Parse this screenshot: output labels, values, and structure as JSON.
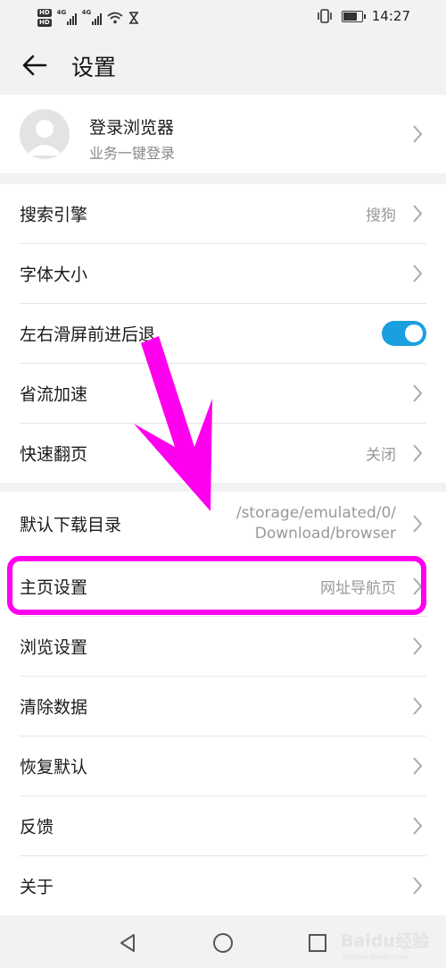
{
  "status_bar": {
    "hd_badges": [
      "HD",
      "HD"
    ],
    "network_labels": [
      "4G",
      "4G"
    ],
    "time": "14:27"
  },
  "header": {
    "title": "设置"
  },
  "account": {
    "name": "登录浏览器",
    "subtitle": "业务一键登录"
  },
  "section1": [
    {
      "label": "搜索引擎",
      "value": "搜狗"
    },
    {
      "label": "字体大小",
      "value": ""
    },
    {
      "label": "左右滑屏前进后退",
      "toggle": true
    },
    {
      "label": "省流加速",
      "value": ""
    },
    {
      "label": "快速翻页",
      "value": "关闭"
    }
  ],
  "section2": [
    {
      "label": "默认下载目录",
      "value_lines": [
        "/storage/emulated/0/",
        "Download/browser"
      ]
    },
    {
      "label": "主页设置",
      "value": "网址导航页"
    },
    {
      "label": "浏览设置",
      "value": ""
    },
    {
      "label": "清除数据",
      "value": ""
    },
    {
      "label": "恢复默认",
      "value": ""
    },
    {
      "label": "反馈",
      "value": ""
    },
    {
      "label": "关于",
      "value": ""
    }
  ],
  "colors": {
    "toggle_on": "#1aa0e0",
    "annotation": "#ff00ee",
    "background": "#f2f2f2"
  },
  "annotation": {
    "type": "arrow-and-highlight",
    "target": "主页设置"
  },
  "watermark": {
    "brand": "Baidu经验",
    "url": "jingyan.baidu.com"
  },
  "icons": [
    "back-arrow-icon",
    "avatar-icon",
    "chevron-right-icon",
    "nav-back-icon",
    "nav-home-icon",
    "nav-recents-icon"
  ]
}
